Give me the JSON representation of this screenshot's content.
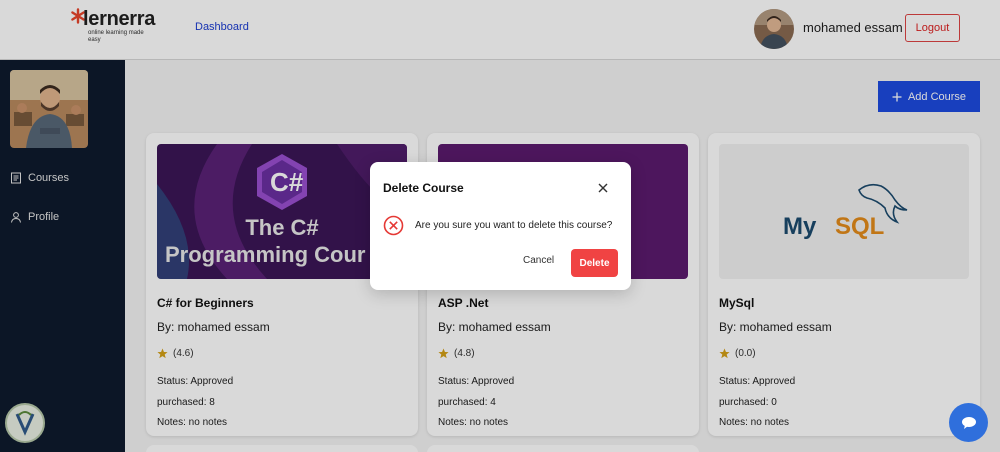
{
  "header": {
    "logo_text": "lernerra",
    "logo_tagline": "online learning made easy",
    "nav_dashboard": "Dashboard",
    "user_name": "mohamed essam",
    "logout_label": "Logout"
  },
  "sidebar": {
    "items": [
      {
        "label": "Courses",
        "icon": "book-icon"
      },
      {
        "label": "Profile",
        "icon": "user-icon"
      }
    ]
  },
  "main": {
    "add_course_label": "Add Course",
    "courses": [
      {
        "image_line1": "The C#",
        "image_line2": "Programming Cour",
        "image_badge": "C#",
        "title": "C# for Beginners",
        "author": "By: mohamed essam",
        "rating": "(4.6)",
        "status": "Status: Approved",
        "purchased": "purchased: 8",
        "notes": "Notes:  no notes"
      },
      {
        "title": "ASP .Net",
        "author": "By: mohamed essam",
        "rating": "(4.8)",
        "status": "Status: Approved",
        "purchased": "purchased: 4",
        "notes": "Notes:  no notes"
      },
      {
        "image_text_my": "My",
        "image_text_sql": "SQL",
        "title": "MySql",
        "author": "By: mohamed essam",
        "rating": "(0.0)",
        "status": "Status: Approved",
        "purchased": "purchased: 0",
        "notes": "Notes:  no notes"
      }
    ]
  },
  "modal": {
    "title": "Delete Course",
    "message": "Are you sure you want to delete this course?",
    "cancel_label": "Cancel",
    "delete_label": "Delete"
  },
  "colors": {
    "primary": "#1d4ae0",
    "sidebar_bg": "#0f1b2d",
    "danger": "#f04343",
    "star": "#d4a017"
  }
}
